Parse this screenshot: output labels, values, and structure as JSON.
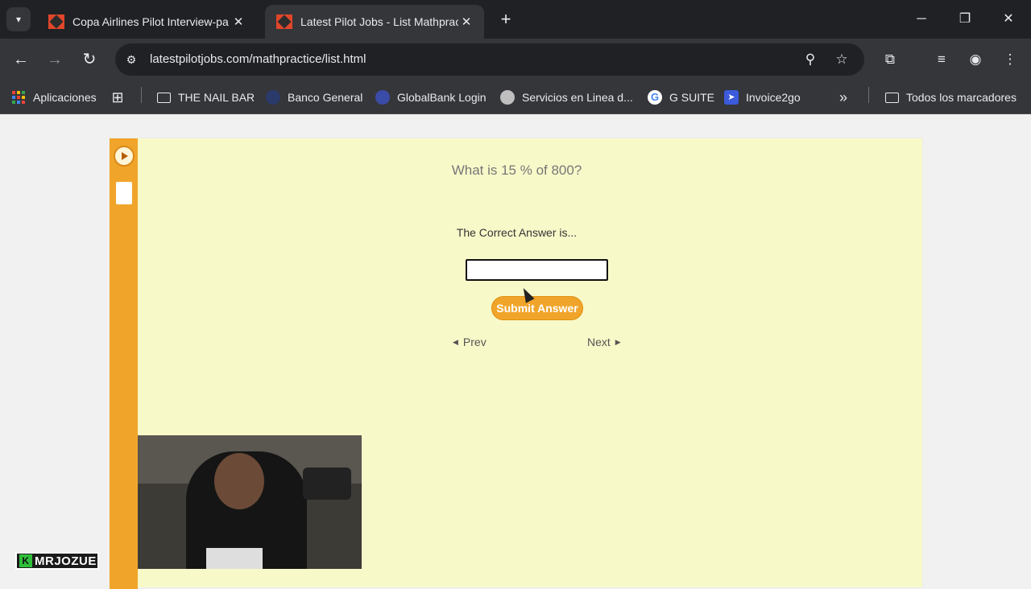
{
  "browser": {
    "tabs": [
      {
        "title": "Copa Airlines Pilot Interview-pa",
        "active": false
      },
      {
        "title": "Latest Pilot Jobs - List Mathprac",
        "active": true
      }
    ],
    "url": "latestpilotjobs.com/mathpractice/list.html",
    "bookmarks": [
      {
        "label": "Aplicaciones",
        "icon": "apps-grid-icon"
      },
      {
        "label": "THE NAIL BAR",
        "icon": "folder-icon"
      },
      {
        "label": "Banco General",
        "icon": "bank-favicon"
      },
      {
        "label": "GlobalBank Login",
        "icon": "globe-favicon"
      },
      {
        "label": "Servicios en Linea d...",
        "icon": "globe-favicon"
      },
      {
        "label": "G SUITE",
        "icon": "google-favicon"
      },
      {
        "label": "Invoice2go",
        "icon": "invoice2go-favicon"
      }
    ],
    "all_bookmarks_label": "Todos los marcadores",
    "tab_close_glyph": "✕",
    "new_tab_glyph": "+"
  },
  "page": {
    "question": "What is 15 % of 800?",
    "answer_label": "The Correct Answer is...",
    "answer_value": "",
    "submit_label": "Submit Answer",
    "prev_label": "Prev",
    "next_label": "Next"
  },
  "overlay": {
    "watermark": "MRJOZUE",
    "watermark_badge": "K"
  },
  "colors": {
    "panel_bg": "#f8f9c9",
    "accent": "#f0a52a",
    "chrome_dark": "#202124",
    "chrome_mid": "#35363a"
  }
}
